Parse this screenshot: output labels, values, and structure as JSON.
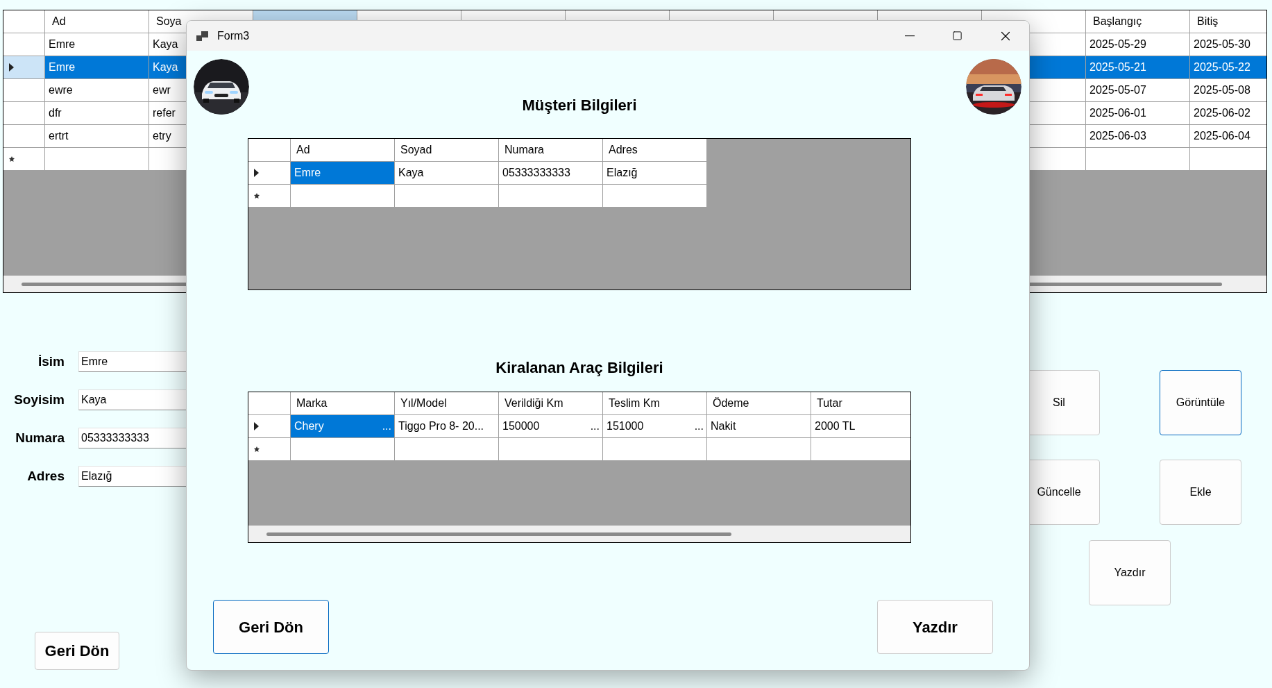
{
  "background_grid": {
    "columns": [
      {
        "label": "Ad",
        "selected": false
      },
      {
        "label": "Soya",
        "selected": false
      },
      {
        "selected": true
      },
      {
        "selected": false
      },
      {
        "selected": false
      },
      {
        "selected": false
      },
      {
        "selected": false
      },
      {
        "selected": false
      },
      {
        "selected": false
      },
      {
        "selected": false
      },
      {
        "label": "Başlangıç",
        "selected": false
      },
      {
        "label": "Bitiş",
        "selected": false
      }
    ],
    "rows": [
      {
        "kind": "data",
        "selected": false,
        "cells": [
          "Emre",
          "Kaya",
          "2025-05-29",
          "2025-05-30"
        ]
      },
      {
        "kind": "data",
        "selected": true,
        "cells": [
          "Emre",
          "Kaya",
          "2025-05-21",
          "2025-05-22"
        ]
      },
      {
        "kind": "data",
        "selected": false,
        "cells": [
          "ewre",
          "ewr",
          "2025-05-07",
          "2025-05-08"
        ]
      },
      {
        "kind": "data",
        "selected": false,
        "cells": [
          "dfr",
          "refer",
          "2025-06-01",
          "2025-06-02"
        ]
      },
      {
        "kind": "data",
        "selected": false,
        "cells": [
          "ertrt",
          "etry",
          "2025-06-03",
          "2025-06-04"
        ]
      },
      {
        "kind": "new",
        "selected": false,
        "cells": []
      }
    ]
  },
  "customer_form": [
    {
      "label": "İsim",
      "value": "Emre"
    },
    {
      "label": "Soyisim",
      "value": "Kaya"
    },
    {
      "label": "Numara",
      "value": "05333333333"
    },
    {
      "label": "Adres",
      "value": "Elazığ"
    }
  ],
  "back_button": {
    "label": "Geri Dön"
  },
  "actions": [
    {
      "label": "Sil",
      "focused": false
    },
    {
      "label": "Görüntüle",
      "focused": true
    },
    {
      "label": "Güncelle",
      "focused": false
    },
    {
      "label": "Ekle",
      "focused": false
    },
    {
      "label": "Yazdır",
      "focused": false
    }
  ],
  "dialog": {
    "title": "Form3",
    "customer_section": {
      "title": "Müşteri Bilgileri",
      "columns": [
        "Ad",
        "Soyad",
        "Numara",
        "Adres"
      ],
      "rows": [
        {
          "kind": "data",
          "current": true,
          "cells": [
            {
              "text": "Emre",
              "selected": true
            },
            {
              "text": "Kaya",
              "selected": false
            },
            {
              "text": "05333333333",
              "selected": false
            },
            {
              "text": "Elazığ",
              "selected": false
            }
          ]
        },
        {
          "kind": "new",
          "current": false,
          "cells": []
        }
      ]
    },
    "vehicle_section": {
      "title": "Kiralanan Araç Bilgileri",
      "columns": [
        "Marka",
        "Yıl/Model",
        "Verildiği Km",
        "Teslim Km",
        "Ödeme",
        "Tutar"
      ],
      "rows": [
        {
          "kind": "data",
          "current": true,
          "cells": [
            {
              "text": "Chery",
              "ellipsis": "...",
              "selected": true
            },
            {
              "text": "Tiggo Pro 8- 20...",
              "selected": false
            },
            {
              "text": "150000",
              "ellipsis": "...",
              "selected": false
            },
            {
              "text": "151000",
              "ellipsis": "...",
              "selected": false
            },
            {
              "text": "Nakit",
              "selected": false
            },
            {
              "text": "2000 TL",
              "selected": false
            }
          ]
        },
        {
          "kind": "new",
          "current": false,
          "cells": []
        }
      ]
    },
    "buttons": [
      {
        "label": "Geri Dön",
        "focused": true
      },
      {
        "label": "Yazdır",
        "focused": false
      }
    ]
  }
}
